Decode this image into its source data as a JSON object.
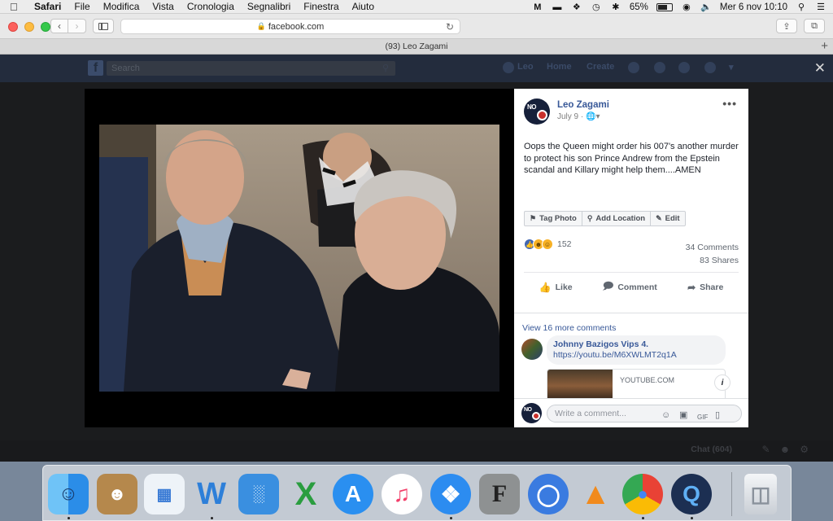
{
  "menubar": {
    "app": "Safari",
    "items": [
      "File",
      "Modifica",
      "Vista",
      "Cronologia",
      "Segnalibri",
      "Finestra",
      "Aiuto"
    ],
    "battery": "65%",
    "datetime": "Mer 6 nov  10:10"
  },
  "browser": {
    "url": "facebook.com",
    "tab_title": "(93) Leo Zagami"
  },
  "post": {
    "author": "Leo Zagami",
    "date": "July 9",
    "text": "Oops the Queen might order his 007's another murder to protect his son Prince Andrew from the Epstein scandal and Killary might help them....AMEN",
    "tag_photo": "Tag Photo",
    "add_location": "Add Location",
    "edit": "Edit",
    "reaction_count": "152",
    "comments_count": "34 Comments",
    "shares_count": "83 Shares",
    "like": "Like",
    "comment": "Comment",
    "share": "Share",
    "view_more": "View 16 more comments",
    "commenter": "Johnny Bazigos Vips 4.",
    "comment_link": "https://youtu.be/M6XWLMT2q1A",
    "link_source": "YOUTUBE.COM",
    "write_placeholder": "Write a comment..."
  },
  "fb_bg": {
    "search": "Search",
    "nav_user": "Leo",
    "nav_home": "Home",
    "nav_create": "Create",
    "chat": "Chat (604)"
  },
  "colors": {
    "fb_blue": "#385898",
    "like_blue": "#4267b2"
  }
}
